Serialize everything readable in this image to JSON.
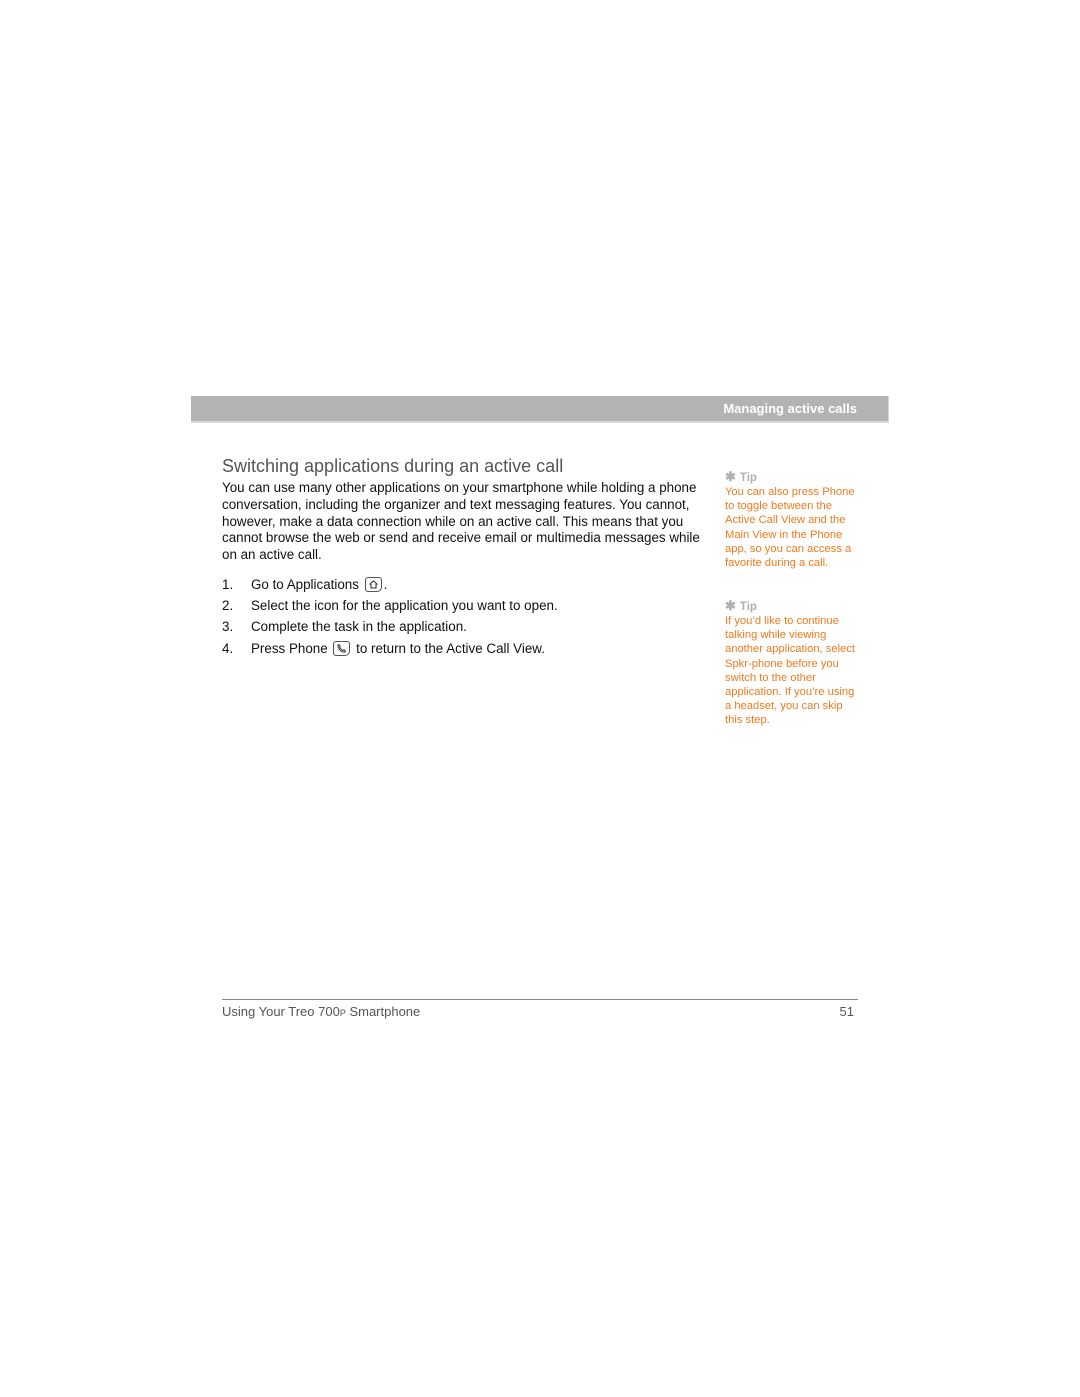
{
  "header": {
    "section_title": "Managing active calls"
  },
  "main": {
    "heading": "Switching applications during an active call",
    "intro": "You can use many other applications on your smartphone while holding a phone conversation, including the organizer and text messaging features. You cannot, however, make a data connection while on an active call. This means that you cannot browse the web or send and receive email or multimedia messages while on an active call.",
    "steps": [
      {
        "num": "1.",
        "before": "Go to Applications",
        "icon": "home-key-icon",
        "after": "."
      },
      {
        "num": "2.",
        "before": "Select the icon for the application you want to open.",
        "icon": null,
        "after": ""
      },
      {
        "num": "3.",
        "before": "Complete the task in the application.",
        "icon": null,
        "after": ""
      },
      {
        "num": "4.",
        "before": "Press Phone",
        "icon": "phone-key-icon",
        "after": "to return to the Active Call View."
      }
    ]
  },
  "sidebar": {
    "tips": [
      {
        "label": "Tip",
        "icon": "asterisk-icon",
        "text": "You can also press Phone to toggle between the Active Call View and the Main View in the Phone app, so you can access a favorite during a call."
      },
      {
        "label": "Tip",
        "icon": "asterisk-icon",
        "text": "If you’d like to continue talking while viewing another application, select Spkr-phone before you switch to the other application. If you’re using a headset, you can skip this step."
      }
    ],
    "tip_color": "#f07a1c"
  },
  "footer": {
    "title_main": "Using Your Treo 700",
    "title_sub": "P",
    "title_end": " Smartphone",
    "page_number": "51"
  }
}
